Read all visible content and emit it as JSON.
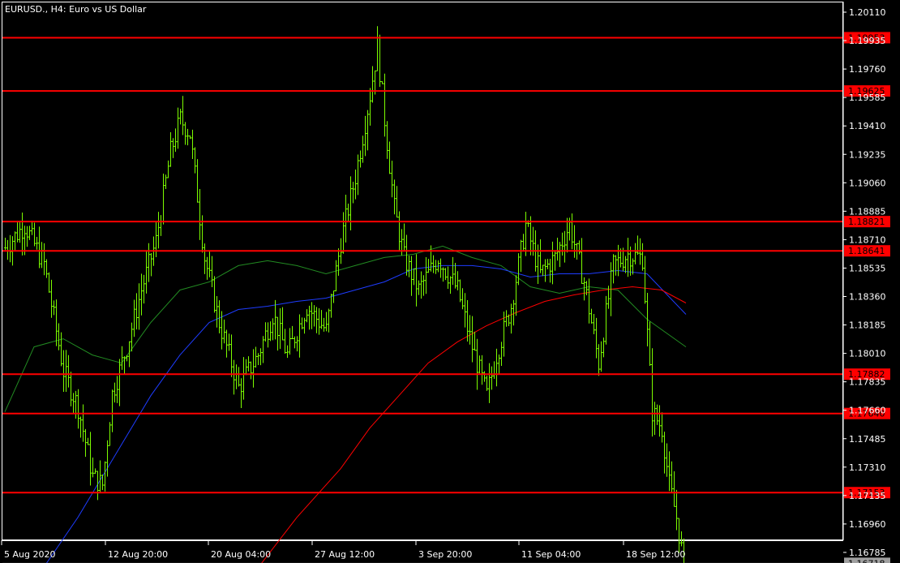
{
  "window": {
    "title": "EURUSD., H4:  Euro vs US Dollar"
  },
  "colors": {
    "background": "#000000",
    "frame": "#ffffff",
    "candle": "#7cfc00",
    "level_line": "#ff0000",
    "bid_line": "#a0a0a0",
    "ma_fast": "#228b22",
    "ma_mid": "#1e3cff",
    "ma_slow": "#ff0000"
  },
  "chart_data": {
    "type": "candlestick",
    "symbol": "EURUSD.",
    "timeframe": "H4",
    "description": "Euro vs US Dollar",
    "ylim": [
      1.1665,
      1.2018
    ],
    "price_ticks": [
      "1.20110",
      "1.19935",
      "1.19760",
      "1.19585",
      "1.19410",
      "1.19235",
      "1.19060",
      "1.18885",
      "1.18710",
      "1.18535",
      "1.18360",
      "1.18185",
      "1.18010",
      "1.17835",
      "1.17660",
      "1.17485",
      "1.17310",
      "1.17135",
      "1.16960",
      "1.16785"
    ],
    "time_labels": [
      "5 Aug 2020",
      "12 Aug 20:00",
      "20 Aug 04:00",
      "27 Aug 12:00",
      "3 Sep 20:00",
      "11 Sep 04:00",
      "18 Sep 12:00"
    ],
    "bar_count": 280,
    "horizontal_levels": [
      "1.19953",
      "1.19625",
      "1.18821",
      "1.18641",
      "1.17882",
      "1.17640",
      "1.17153"
    ],
    "current_price": "1.16718",
    "close_path": [
      [
        0,
        1.1866
      ],
      [
        8,
        1.188
      ],
      [
        16,
        1.1856
      ],
      [
        24,
        1.179
      ],
      [
        30,
        1.1768
      ],
      [
        36,
        1.1725
      ],
      [
        40,
        1.172
      ],
      [
        44,
        1.1776
      ],
      [
        50,
        1.1805
      ],
      [
        56,
        1.184
      ],
      [
        62,
        1.187
      ],
      [
        68,
        1.1925
      ],
      [
        72,
        1.1945
      ],
      [
        76,
        1.1936
      ],
      [
        82,
        1.186
      ],
      [
        88,
        1.182
      ],
      [
        96,
        1.178
      ],
      [
        104,
        1.18
      ],
      [
        110,
        1.1825
      ],
      [
        116,
        1.18
      ],
      [
        124,
        1.183
      ],
      [
        132,
        1.1815
      ],
      [
        138,
        1.187
      ],
      [
        144,
        1.191
      ],
      [
        150,
        1.196
      ],
      [
        153,
        1.199
      ],
      [
        156,
        1.1945
      ],
      [
        160,
        1.189
      ],
      [
        164,
        1.186
      ],
      [
        170,
        1.184
      ],
      [
        178,
        1.186
      ],
      [
        186,
        1.184
      ],
      [
        192,
        1.1805
      ],
      [
        198,
        1.1775
      ],
      [
        202,
        1.18
      ],
      [
        208,
        1.183
      ],
      [
        214,
        1.188
      ],
      [
        220,
        1.185
      ],
      [
        226,
        1.186
      ],
      [
        232,
        1.188
      ],
      [
        238,
        1.1845
      ],
      [
        244,
        1.1795
      ],
      [
        250,
        1.1855
      ],
      [
        256,
        1.1862
      ],
      [
        262,
        1.186
      ],
      [
        266,
        1.1765
      ],
      [
        270,
        1.1755
      ],
      [
        273,
        1.172
      ],
      [
        276,
        1.17
      ],
      [
        279,
        1.1671
      ]
    ],
    "moving_averages": [
      {
        "color": "#228b22",
        "values": [
          [
            0,
            1.1765
          ],
          [
            12,
            1.1805
          ],
          [
            24,
            1.181
          ],
          [
            36,
            1.18
          ],
          [
            48,
            1.1795
          ],
          [
            60,
            1.182
          ],
          [
            72,
            1.184
          ],
          [
            84,
            1.1845
          ],
          [
            96,
            1.1855
          ],
          [
            108,
            1.1858
          ],
          [
            120,
            1.1855
          ],
          [
            132,
            1.185
          ],
          [
            144,
            1.1855
          ],
          [
            156,
            1.186
          ],
          [
            168,
            1.1862
          ],
          [
            180,
            1.1867
          ],
          [
            192,
            1.186
          ],
          [
            204,
            1.1855
          ],
          [
            216,
            1.1842
          ],
          [
            228,
            1.1838
          ],
          [
            240,
            1.1842
          ],
          [
            252,
            1.184
          ],
          [
            264,
            1.1822
          ],
          [
            280,
            1.1805
          ]
        ]
      },
      {
        "color": "#1e3cff",
        "values": [
          [
            14,
            1.1665
          ],
          [
            30,
            1.17
          ],
          [
            48,
            1.1745
          ],
          [
            60,
            1.1775
          ],
          [
            72,
            1.18
          ],
          [
            84,
            1.182
          ],
          [
            96,
            1.1828
          ],
          [
            108,
            1.183
          ],
          [
            120,
            1.1833
          ],
          [
            132,
            1.1835
          ],
          [
            144,
            1.184
          ],
          [
            156,
            1.1845
          ],
          [
            168,
            1.1853
          ],
          [
            180,
            1.1855
          ],
          [
            192,
            1.1855
          ],
          [
            204,
            1.1853
          ],
          [
            216,
            1.1848
          ],
          [
            228,
            1.185
          ],
          [
            240,
            1.185
          ],
          [
            252,
            1.1852
          ],
          [
            264,
            1.185
          ],
          [
            280,
            1.1825
          ]
        ]
      },
      {
        "color": "#ff0000",
        "values": [
          [
            102,
            1.1665
          ],
          [
            120,
            1.17
          ],
          [
            138,
            1.173
          ],
          [
            150,
            1.1755
          ],
          [
            162,
            1.1775
          ],
          [
            174,
            1.1795
          ],
          [
            186,
            1.1808
          ],
          [
            198,
            1.1818
          ],
          [
            210,
            1.1826
          ],
          [
            222,
            1.1833
          ],
          [
            234,
            1.1837
          ],
          [
            246,
            1.184
          ],
          [
            258,
            1.1842
          ],
          [
            270,
            1.184
          ],
          [
            280,
            1.1832
          ]
        ]
      }
    ]
  }
}
